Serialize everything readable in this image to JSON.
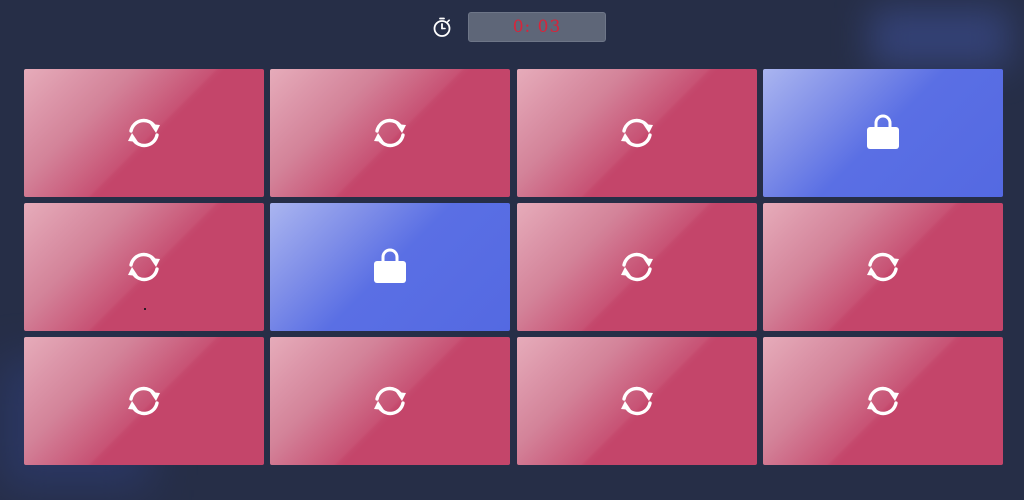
{
  "header": {
    "timer_icon": "stopwatch-icon",
    "timer_value": "0: 03"
  },
  "colors": {
    "background": "#262e47",
    "tile_hidden": "#c4456a",
    "tile_revealed": "#5469e2",
    "timer_text": "#d8243a"
  },
  "board": {
    "rows": 3,
    "cols": 4,
    "tiles": [
      {
        "state": "hidden",
        "icon": "refresh-icon"
      },
      {
        "state": "hidden",
        "icon": "refresh-icon"
      },
      {
        "state": "hidden",
        "icon": "refresh-icon"
      },
      {
        "state": "revealed",
        "icon": "shopping-bag-icon"
      },
      {
        "state": "hidden",
        "icon": "refresh-icon"
      },
      {
        "state": "revealed",
        "icon": "shopping-bag-icon"
      },
      {
        "state": "hidden",
        "icon": "refresh-icon"
      },
      {
        "state": "hidden",
        "icon": "refresh-icon"
      },
      {
        "state": "hidden",
        "icon": "refresh-icon"
      },
      {
        "state": "hidden",
        "icon": "refresh-icon"
      },
      {
        "state": "hidden",
        "icon": "refresh-icon"
      },
      {
        "state": "hidden",
        "icon": "refresh-icon"
      }
    ]
  }
}
